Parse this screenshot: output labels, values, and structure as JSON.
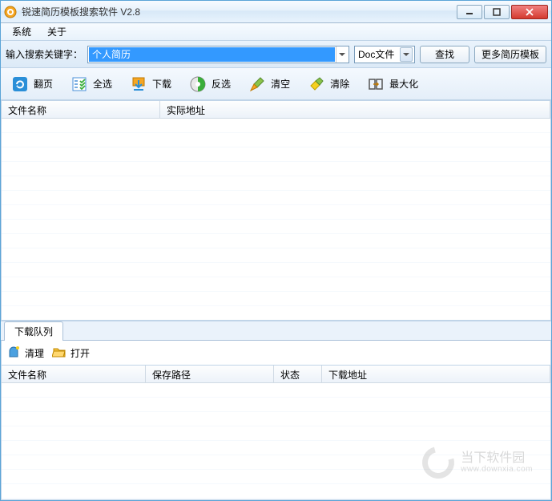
{
  "window": {
    "title": "锐速简历模板搜索软件  V2.8"
  },
  "menubar": {
    "system": "系统",
    "about": "关于"
  },
  "searchbar": {
    "label": "输入搜索关键字：",
    "keyword_value": "个人简历",
    "filetype_selected": "Doc文件",
    "search_btn": "查找",
    "more_btn": "更多简历模板"
  },
  "toolbar": {
    "page": "翻页",
    "select_all": "全选",
    "download": "下载",
    "invert": "反选",
    "clear_empty": "清空",
    "clear": "清除",
    "maximize": "最大化"
  },
  "results_grid": {
    "col_filename": "文件名称",
    "col_url": "实际地址"
  },
  "download_panel": {
    "tab": "下载队列",
    "clean": "清理",
    "open": "打开",
    "col_filename": "文件名称",
    "col_path": "保存路径",
    "col_status": "状态",
    "col_dlurl": "下载地址"
  },
  "watermark": {
    "name": "当下软件园",
    "url": "www.downxia.com"
  }
}
